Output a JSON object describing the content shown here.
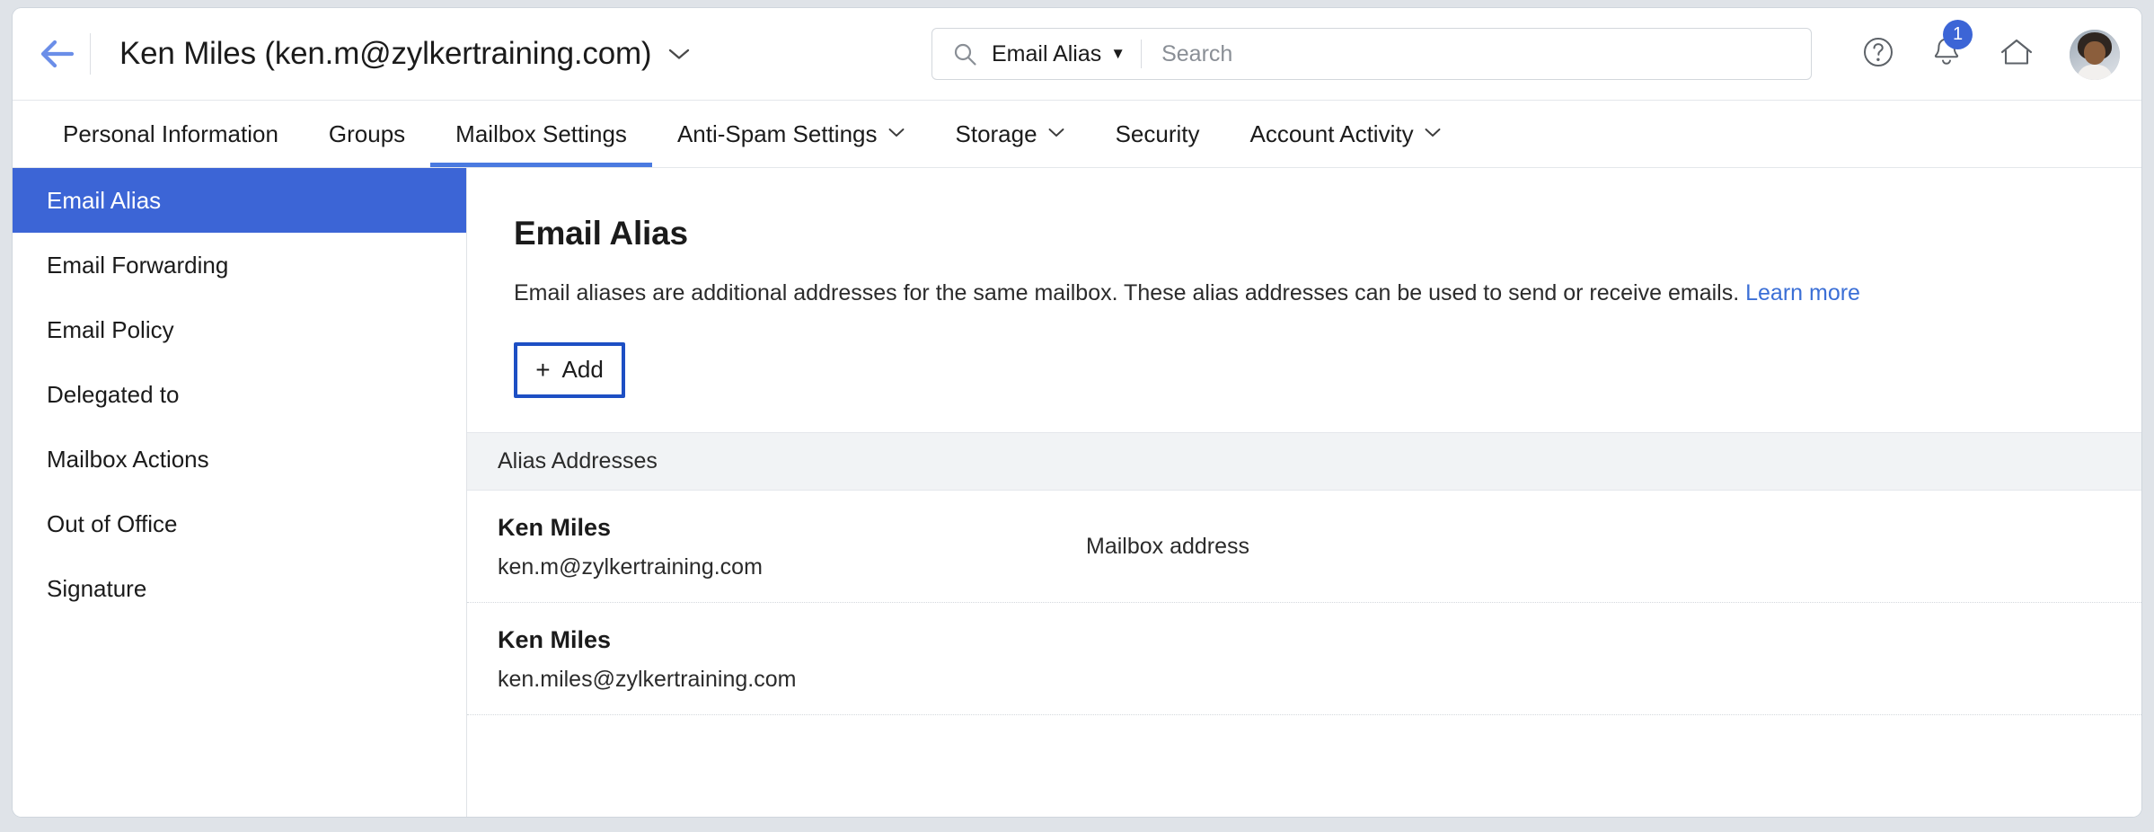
{
  "colors": {
    "accent_blue": "#3c65d6",
    "link_blue": "#3b6fd6",
    "tab_underline": "#4a7ae0",
    "back_arrow": "#6b8ee8",
    "add_button_border": "#1d4fc4",
    "table_header_bg": "#f1f3f5",
    "page_bg": "#dfe3e8"
  },
  "topbar": {
    "back_icon": "back-arrow-icon",
    "account_title": "Ken Miles (ken.m@zylkertraining.com)",
    "account_chevron": "⌄",
    "search": {
      "icon": "search-icon",
      "scope_label": "Email Alias",
      "scope_caret": "▼",
      "placeholder": "Search",
      "value": ""
    },
    "actions": {
      "help_icon": "help-circle-icon",
      "help_glyph": "?",
      "notifications_icon": "bell-icon",
      "notifications_count": "1",
      "home_icon": "home-icon",
      "avatar_icon": "user-avatar"
    }
  },
  "tabs": [
    {
      "label": "Personal Information",
      "has_caret": false,
      "active": false
    },
    {
      "label": "Groups",
      "has_caret": false,
      "active": false
    },
    {
      "label": "Mailbox Settings",
      "has_caret": false,
      "active": true
    },
    {
      "label": "Anti-Spam Settings",
      "has_caret": true,
      "active": false
    },
    {
      "label": "Storage",
      "has_caret": true,
      "active": false
    },
    {
      "label": "Security",
      "has_caret": false,
      "active": false
    },
    {
      "label": "Account Activity",
      "has_caret": true,
      "active": false
    }
  ],
  "sidebar": {
    "items": [
      {
        "label": "Email Alias",
        "active": true
      },
      {
        "label": "Email Forwarding",
        "active": false
      },
      {
        "label": "Email Policy",
        "active": false
      },
      {
        "label": "Delegated to",
        "active": false
      },
      {
        "label": "Mailbox Actions",
        "active": false
      },
      {
        "label": "Out of Office",
        "active": false
      },
      {
        "label": "Signature",
        "active": false
      }
    ]
  },
  "main": {
    "title": "Email Alias",
    "description": "Email aliases are additional addresses for the same mailbox. These alias addresses can be used to send or receive emails.",
    "learn_more_label": "Learn more",
    "add_button": {
      "plus": "+",
      "label": "Add"
    },
    "table": {
      "header": "Alias Addresses",
      "rows": [
        {
          "name": "Ken Miles",
          "email": "ken.m@zylkertraining.com",
          "tag": "Mailbox address"
        },
        {
          "name": "Ken Miles",
          "email": "ken.miles@zylkertraining.com",
          "tag": ""
        }
      ]
    }
  }
}
